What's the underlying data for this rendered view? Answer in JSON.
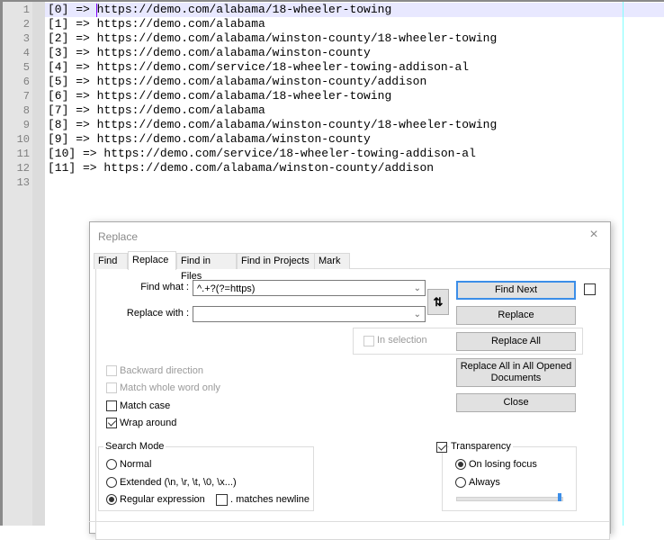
{
  "editor": {
    "current_line": 1,
    "lines": [
      {
        "num": "1",
        "text": "[0] => https://demo.com/alabama/18-wheeler-towing"
      },
      {
        "num": "2",
        "text": "[1] => https://demo.com/alabama"
      },
      {
        "num": "3",
        "text": "[2] => https://demo.com/alabama/winston-county/18-wheeler-towing"
      },
      {
        "num": "4",
        "text": "[3] => https://demo.com/alabama/winston-county"
      },
      {
        "num": "5",
        "text": "[4] => https://demo.com/service/18-wheeler-towing-addison-al"
      },
      {
        "num": "6",
        "text": "[5] => https://demo.com/alabama/winston-county/addison"
      },
      {
        "num": "7",
        "text": "[6] => https://demo.com/alabama/18-wheeler-towing"
      },
      {
        "num": "8",
        "text": "[7] => https://demo.com/alabama"
      },
      {
        "num": "9",
        "text": "[8] => https://demo.com/alabama/winston-county/18-wheeler-towing"
      },
      {
        "num": "10",
        "text": "[9] => https://demo.com/alabama/winston-county"
      },
      {
        "num": "11",
        "text": "[10] => https://demo.com/service/18-wheeler-towing-addison-al"
      },
      {
        "num": "12",
        "text": "[11] => https://demo.com/alabama/winston-county/addison"
      },
      {
        "num": "13",
        "text": ""
      }
    ]
  },
  "dialog": {
    "title": "Replace",
    "close_icon": "×",
    "tabs": [
      {
        "label": "Find",
        "active": false
      },
      {
        "label": "Replace",
        "active": true
      },
      {
        "label": "Find in Files",
        "active": false
      },
      {
        "label": "Find in Projects",
        "active": false
      },
      {
        "label": "Mark",
        "active": false
      }
    ],
    "find_what_label": "Find what :",
    "find_what_value": "^.+?(?=https)",
    "replace_with_label": "Replace with :",
    "replace_with_value": "",
    "swap_icon": "⇅",
    "in_selection": {
      "label": "In selection",
      "checked": false,
      "enabled": false
    },
    "buttons": {
      "find_next": "Find Next",
      "replace": "Replace",
      "replace_all": "Replace All",
      "replace_all_opened": "Replace All in All Opened Documents",
      "close": "Close"
    },
    "find_next_extra_checkbox": false,
    "options": {
      "backward_direction": {
        "label": "Backward direction",
        "checked": false,
        "enabled": false
      },
      "match_whole_word": {
        "label": "Match whole word only",
        "checked": false,
        "enabled": false
      },
      "match_case": {
        "label": "Match case",
        "checked": false,
        "enabled": true
      },
      "wrap_around": {
        "label": "Wrap around",
        "checked": true,
        "enabled": true
      }
    },
    "search_mode": {
      "label": "Search Mode",
      "options": [
        {
          "label": "Normal",
          "selected": false
        },
        {
          "label": "Extended (\\n, \\r, \\t, \\0, \\x...)",
          "selected": false
        },
        {
          "label": "Regular expression",
          "selected": true
        }
      ],
      "matches_newline": {
        "label": ". matches newline",
        "checked": false
      }
    },
    "transparency": {
      "label": "Transparency",
      "checked": true,
      "options": [
        {
          "label": "On losing focus",
          "selected": true
        },
        {
          "label": "Always",
          "selected": false
        }
      ],
      "slider_value_percent": 100
    }
  }
}
